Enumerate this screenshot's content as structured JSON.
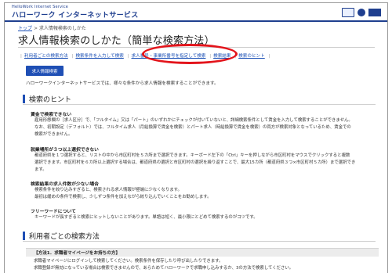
{
  "header": {
    "logo_sub": "HelloWork Internet Service",
    "logo_main": "ハローワーク インターネットサービス"
  },
  "breadcrumb": {
    "home": "トップ",
    "separator": ">",
    "current": "求人情報検索のしかた"
  },
  "page_title": "求人情報検索のしかた（簡単な検索方法）",
  "nav": {
    "items": [
      "利用者ごとの検索方法",
      "検索条件を入力して検索",
      "求人番号・事業所番号を指定して検索",
      "検索結果",
      "検索のヒント"
    ]
  },
  "search_button": "求人情報検索",
  "description": "ハローワークインターネットサービスでは、様々な条件から求人情報を検索することができます。",
  "hints": {
    "heading": "検索のヒント",
    "items": [
      {
        "title": "賃金で検索できない",
        "lines": [
          "雇用形態欄の［求人区分］で、「フルタイム」又は「パート」のいずれかにチェックが付いていないと、詳細検索条件として賃金を入力して検索することができません。",
          "なお、初期設定（デフォルト）では、フルタイム求人（月給換算で賃金を検索）とパート求人（時給換算で賃金を検索）の両方が検索対象となっているため、賃金での",
          "検索ができません。"
        ]
      },
      {
        "title": "就業場所が３つ以上選択できない",
        "lines": [
          "都道府県を１つ選択すると、リストの中から市区町村を５カ所まで選択できます。キーボード左下の「Ctrl」キーを押しながら市区町村をマウスでクリックすると複数",
          "選択できます。市区町村を６カ所以上選択する場合は、都道府県の選択と市区町村の選択を繰り返すことで、最大15カ所（都道府県３つ×市区町村５カ所）まで選択でき",
          "ます。"
        ]
      },
      {
        "title": "検索結果の求人件数が少ない場合",
        "lines": [
          "検索条件を絞り込みすぎると、検索される求人情報が極端に少なくなります。",
          "最初は緩めの条件で検索し、少しずつ条件を加えながら絞り込んでいくことをお勧めします。"
        ]
      },
      {
        "title": "フリーワードについて",
        "lines": [
          "キーワードが長すぎると検索にヒットしないことがあります。単語は短く、最小限にとどめて検索するのがコツです。"
        ]
      }
    ]
  },
  "users": {
    "heading": "利用者ごとの検索方法",
    "box_title": "【方法1．求職者マイページをお持ちの方】",
    "lines": [
      "求職者マイページにログインして検索してください。検索条件を保存したり呼び出したりできます。",
      "求職登録が無効になっている場合は検索できませんので、あらためてハローワークで求職申し込みするか、3の方法で検索してください。"
    ]
  },
  "colors": {
    "brand_blue": "#1f3f8f",
    "link_blue": "#1a4fb5",
    "annotation_red": "#e3141b"
  },
  "icons": [
    "language-icon",
    "accessibility-icon",
    "ministry-logo-icon"
  ]
}
